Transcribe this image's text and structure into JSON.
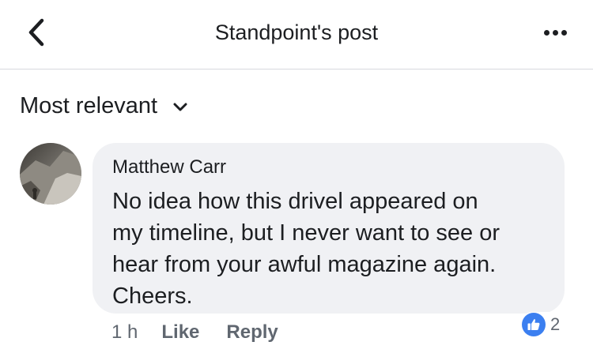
{
  "header": {
    "title": "Standpoint's post",
    "back_icon": "chevron-left-icon",
    "more_icon": "more-dots-icon"
  },
  "sort": {
    "label": "Most relevant",
    "icon": "chevron-down-icon"
  },
  "comment": {
    "author": "Matthew Carr",
    "text": "No idea how this drivel appeared on\nmy timeline, but I never want to see or\nhear from your awful magazine again.\nCheers.",
    "time": "1 h",
    "like_label": "Like",
    "reply_label": "Reply",
    "reaction_count": "2",
    "reaction_icon": "like-thumb-icon"
  },
  "colors": {
    "accent": "#3b7ff0",
    "bubble": "#f0f1f4",
    "secondary_text": "#606770",
    "primary_text": "#1c1e21"
  }
}
